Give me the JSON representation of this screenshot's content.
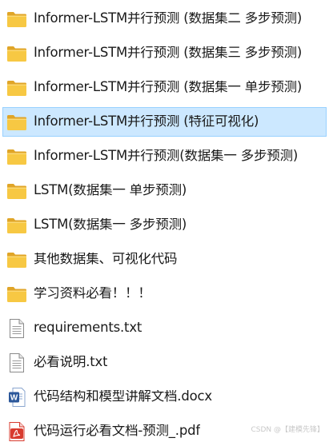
{
  "files": [
    {
      "name": "Informer-LSTM并行预测 (数据集二 多步预测)",
      "icon": "folder-icon",
      "selected": false
    },
    {
      "name": "Informer-LSTM并行预测 (数据集三 多步预测)",
      "icon": "folder-icon",
      "selected": false
    },
    {
      "name": "Informer-LSTM并行预测 (数据集一 单步预测)",
      "icon": "folder-icon",
      "selected": false
    },
    {
      "name": "Informer-LSTM并行预测 (特征可视化)",
      "icon": "folder-icon",
      "selected": true
    },
    {
      "name": "Informer-LSTM并行预测(数据集一 多步预测)",
      "icon": "folder-icon",
      "selected": false
    },
    {
      "name": "LSTM(数据集一 单步预测)",
      "icon": "folder-icon",
      "selected": false
    },
    {
      "name": "LSTM(数据集一 多步预测)",
      "icon": "folder-icon",
      "selected": false
    },
    {
      "name": "其他数据集、可视化代码",
      "icon": "folder-icon",
      "selected": false
    },
    {
      "name": "学习资料必看！！！",
      "icon": "folder-icon",
      "selected": false
    },
    {
      "name": "requirements.txt",
      "icon": "text-file-icon",
      "selected": false
    },
    {
      "name": "必看说明.txt",
      "icon": "text-file-icon",
      "selected": false
    },
    {
      "name": "代码结构和模型讲解文档.docx",
      "icon": "word-doc-icon",
      "selected": false
    },
    {
      "name": "代码运行必看文档-预测_.pdf",
      "icon": "pdf-file-icon",
      "selected": false
    }
  ],
  "watermark": "CSDN @【建模先锋】",
  "colors": {
    "selection_bg": "#cce8ff",
    "selection_border": "#99d1ff",
    "folder": "#f0c14b",
    "word": "#2b579a",
    "pdf": "#d83b2f"
  }
}
